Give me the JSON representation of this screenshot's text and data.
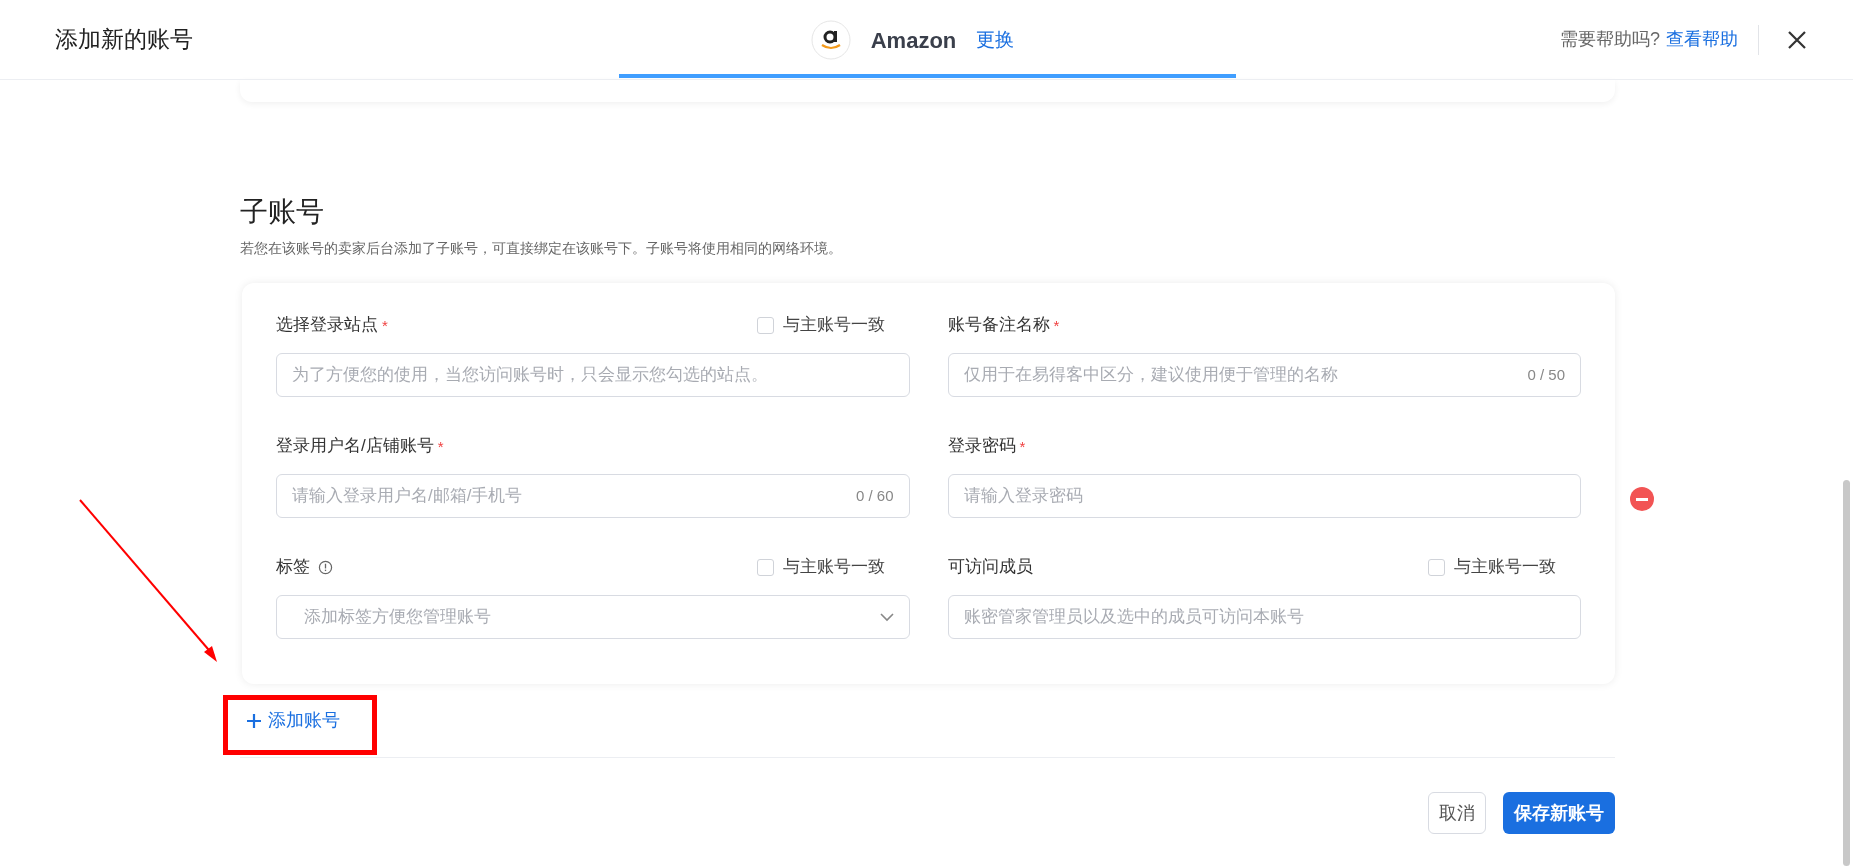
{
  "header": {
    "title": "添加新的账号",
    "platform": {
      "name": "Amazon",
      "change_link": "更换"
    },
    "help_prompt": "需要帮助吗?",
    "help_link": "查看帮助"
  },
  "section": {
    "title": "子账号",
    "description": "若您在该账号的卖家后台添加了子账号，可直接绑定在该账号下。子账号将使用相同的网络环境。"
  },
  "fields": [
    {
      "kind": "select",
      "label": "选择登录站点",
      "required_mark": "*",
      "info": false,
      "sync_checkbox": {
        "label": "与主账号一致",
        "checked": false
      },
      "placeholder": "为了方便您的使用，当您访问账号时，只会显示您勾选的站点。"
    },
    {
      "kind": "text",
      "label": "账号备注名称",
      "required_mark": "*",
      "info": false,
      "placeholder": "仅用于在易得客中区分，建议使用便于管理的名称",
      "counter": "0 / 50"
    },
    {
      "kind": "text",
      "label": "登录用户名/店铺账号",
      "required_mark": "*",
      "info": false,
      "placeholder": "请输入登录用户名/邮箱/手机号",
      "counter": "0 / 60"
    },
    {
      "kind": "text",
      "label": "登录密码",
      "required_mark": "*",
      "info": false,
      "placeholder": "请输入登录密码"
    },
    {
      "kind": "dropdown",
      "label": "标签",
      "info": true,
      "sync_checkbox": {
        "label": "与主账号一致",
        "checked": false
      },
      "placeholder": "添加标签方便您管理账号"
    },
    {
      "kind": "text",
      "label": "可访问成员",
      "info": false,
      "sync_checkbox": {
        "label": "与主账号一致",
        "checked": false
      },
      "placeholder": "账密管家管理员以及选中的成员可访问本账号"
    }
  ],
  "add_account_link": "添加账号",
  "buttons": [
    {
      "kind": "secondary",
      "label": "取消"
    },
    {
      "kind": "primary",
      "label": "保存新账号"
    }
  ]
}
